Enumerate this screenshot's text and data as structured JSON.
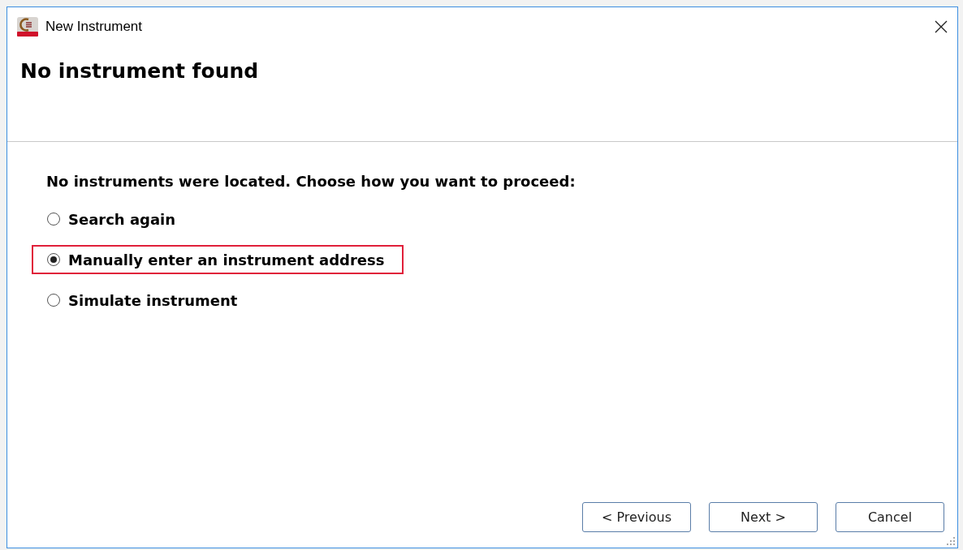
{
  "window": {
    "title": "New Instrument"
  },
  "heading": "No instrument found",
  "prompt": "No instruments were located. Choose how you want to proceed:",
  "options": [
    {
      "label": "Search again",
      "selected": false,
      "highlighted": false
    },
    {
      "label": "Manually enter an instrument address",
      "selected": true,
      "highlighted": true
    },
    {
      "label": "Simulate instrument",
      "selected": false,
      "highlighted": false
    }
  ],
  "buttons": [
    "< Previous",
    "Next >",
    "Cancel"
  ]
}
